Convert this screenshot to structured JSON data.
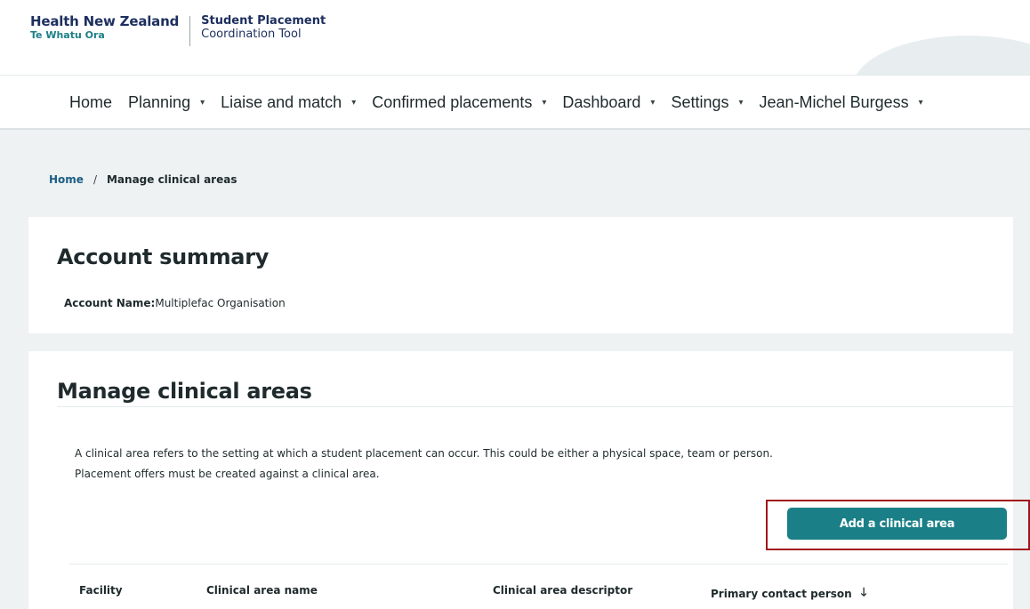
{
  "header": {
    "brand_name": "Health New Zealand",
    "brand_sub": "Te Whatu Ora",
    "tool_name_line1": "Student Placement",
    "tool_name_line2": "Coordination Tool"
  },
  "nav": {
    "items": [
      {
        "label": "Home",
        "has_dropdown": false
      },
      {
        "label": "Planning",
        "has_dropdown": true
      },
      {
        "label": "Liaise and match",
        "has_dropdown": true
      },
      {
        "label": "Confirmed placements",
        "has_dropdown": true
      },
      {
        "label": "Dashboard",
        "has_dropdown": true
      },
      {
        "label": "Settings",
        "has_dropdown": true
      },
      {
        "label": "Jean-Michel Burgess",
        "has_dropdown": true
      }
    ],
    "caret_glyph": "▾"
  },
  "breadcrumb": {
    "home": "Home",
    "separator": "/",
    "current": "Manage clinical areas"
  },
  "account_summary": {
    "title": "Account summary",
    "account_name_label": "Account Name:",
    "account_name_value": "Multiplefac Organisation"
  },
  "manage": {
    "title": "Manage clinical areas",
    "description_line1": "A clinical area refers to the setting at which a student placement can occur. This could be either a physical space, team or person.",
    "description_line2": "Placement offers must be created against a clinical area.",
    "add_button_label": "Add a clinical area"
  },
  "table": {
    "columns": [
      {
        "label": "Facility"
      },
      {
        "label": "Clinical area name"
      },
      {
        "label": "Clinical area descriptor"
      },
      {
        "label": "Primary contact person",
        "sort": "descending"
      }
    ],
    "sort_glyph": "🡓"
  },
  "colors": {
    "brand_navy": "#1d2f5f",
    "brand_teal": "#1b7f86",
    "button_teal": "#1a7f86",
    "highlight_red": "#a2161c",
    "link_blue": "#1a5d86",
    "page_bg": "#eef2f2"
  },
  "icons": {
    "dropdown": "caret-down-icon",
    "sort": "arrow-down-icon"
  }
}
